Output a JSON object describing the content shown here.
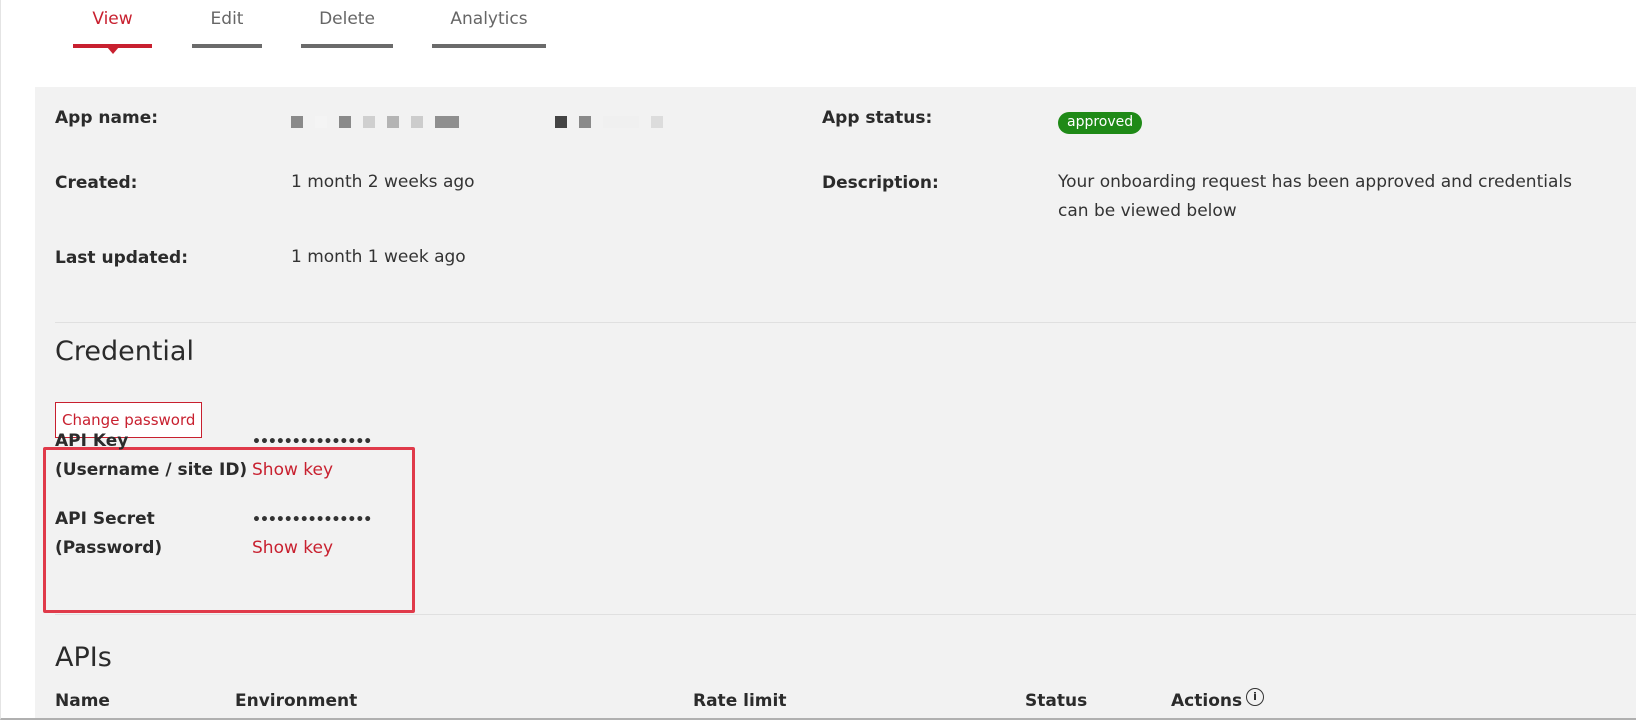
{
  "tabs": [
    {
      "label": "View",
      "active": true
    },
    {
      "label": "Edit",
      "active": false
    },
    {
      "label": "Delete",
      "active": false
    },
    {
      "label": "Analytics",
      "active": false
    }
  ],
  "details": {
    "app_name_label": "App name:",
    "app_name_value": "[redacted]",
    "created_label": "Created:",
    "created_value": "1 month 2 weeks ago",
    "last_updated_label": "Last updated:",
    "last_updated_value": "1 month 1 week ago",
    "app_status_label": "App status:",
    "app_status_value": "approved",
    "description_label": "Description:",
    "description_value": "Your onboarding request has been approved and credentials can be viewed below"
  },
  "credential": {
    "title": "Credential",
    "change_password_label": "Change password",
    "api_key_label_line1": "API Key",
    "api_key_label_line2": "(Username / site ID)",
    "api_key_masked": "•••••••••••••••",
    "api_key_show_label": "Show key",
    "api_secret_label_line1": "API Secret",
    "api_secret_label_line2": "(Password)",
    "api_secret_masked": "•••••••••••••••",
    "api_secret_show_label": "Show key"
  },
  "apis": {
    "title": "APIs",
    "columns": [
      "Name",
      "Environment",
      "Rate limit",
      "Status",
      "Actions"
    ],
    "info_icon": "info-icon"
  },
  "colors": {
    "accent": "#c8202f",
    "status_approved": "#1f8a17",
    "panel_bg": "#f2f2f2",
    "highlight": "#e03a4a"
  }
}
